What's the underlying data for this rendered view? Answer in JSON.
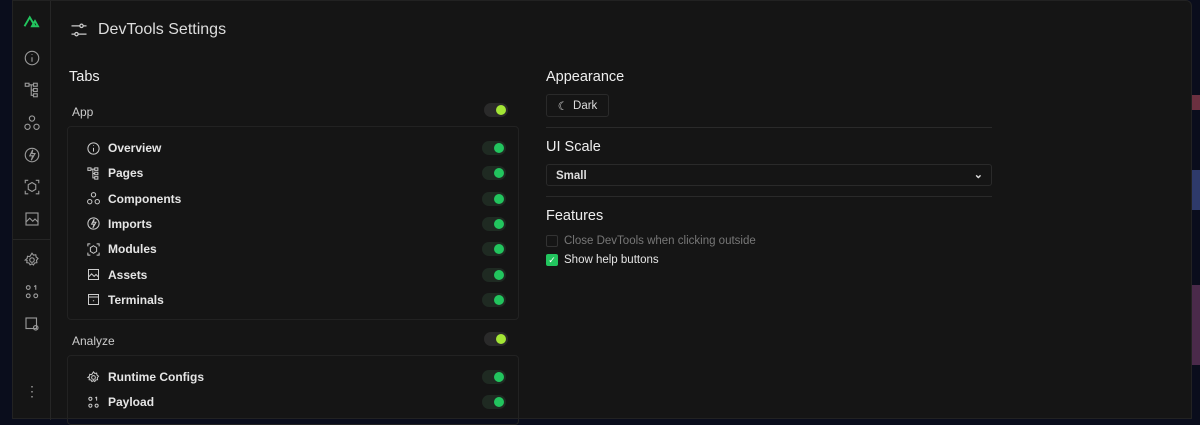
{
  "title": "DevTools Settings",
  "tabs_heading": "Tabs",
  "categories": [
    {
      "label": "App",
      "enabled": true,
      "items": [
        {
          "label": "Overview",
          "icon": "info-icon",
          "enabled": true
        },
        {
          "label": "Pages",
          "icon": "tree-icon",
          "enabled": true
        },
        {
          "label": "Components",
          "icon": "components-icon",
          "enabled": true
        },
        {
          "label": "Imports",
          "icon": "lightning-icon",
          "enabled": true
        },
        {
          "label": "Modules",
          "icon": "cube-icon",
          "enabled": true
        },
        {
          "label": "Assets",
          "icon": "image-icon",
          "enabled": true
        },
        {
          "label": "Terminals",
          "icon": "terminal-icon",
          "enabled": true
        }
      ]
    },
    {
      "label": "Analyze",
      "enabled": true,
      "items": [
        {
          "label": "Runtime Configs",
          "icon": "gear-icon",
          "enabled": true
        },
        {
          "label": "Payload",
          "icon": "payload-icon",
          "enabled": true
        }
      ]
    }
  ],
  "appearance": {
    "heading": "Appearance",
    "button": "Dark"
  },
  "ui_scale": {
    "heading": "UI Scale",
    "value": "Small"
  },
  "features": {
    "heading": "Features",
    "options": [
      {
        "label": "Close DevTools when clicking outside",
        "checked": false
      },
      {
        "label": "Show help buttons",
        "checked": true
      }
    ]
  },
  "colors": {
    "accent": "#22c55e",
    "category_toggle": "#a3e635"
  }
}
